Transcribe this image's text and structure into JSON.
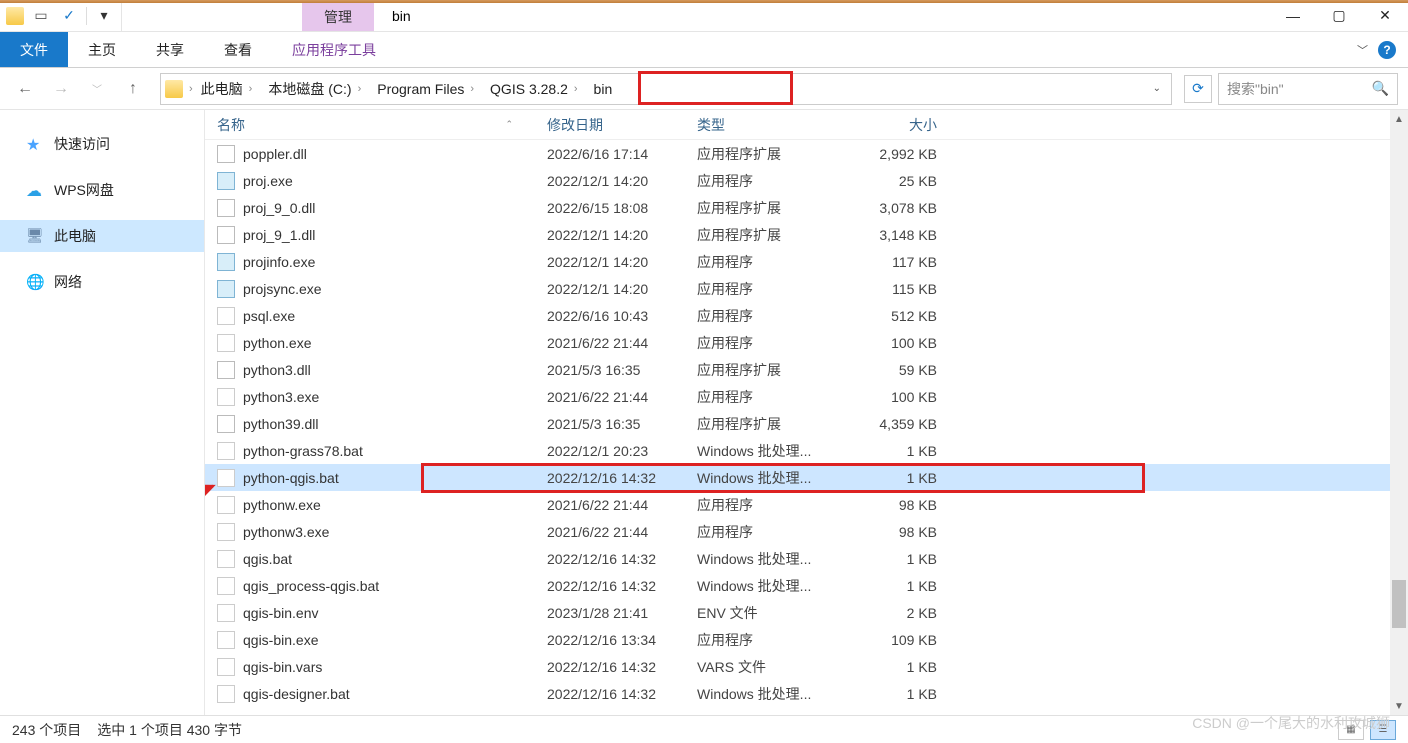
{
  "title": {
    "context_tab": "管理",
    "window": "bin"
  },
  "ribbon": {
    "file": "文件",
    "tabs": [
      "主页",
      "共享",
      "查看"
    ],
    "context": "应用程序工具"
  },
  "breadcrumb": {
    "items": [
      "此电脑",
      "本地磁盘 (C:)",
      "Program Files",
      "QGIS 3.28.2",
      "bin"
    ]
  },
  "search": {
    "placeholder": "搜索\"bin\""
  },
  "navpane": {
    "items": [
      {
        "label": "快速访问"
      },
      {
        "label": "WPS网盘"
      },
      {
        "label": "此电脑"
      },
      {
        "label": "网络"
      }
    ]
  },
  "columns": {
    "name": "名称",
    "date": "修改日期",
    "type": "类型",
    "size": "大小"
  },
  "files": [
    {
      "name": "poppler.dll",
      "date": "2022/6/16 17:14",
      "type": "应用程序扩展",
      "size": "2,992 KB",
      "ico": "ico-dll"
    },
    {
      "name": "proj.exe",
      "date": "2022/12/1 14:20",
      "type": "应用程序",
      "size": "25 KB",
      "ico": "ico-exe-proj"
    },
    {
      "name": "proj_9_0.dll",
      "date": "2022/6/15 18:08",
      "type": "应用程序扩展",
      "size": "3,078 KB",
      "ico": "ico-dll"
    },
    {
      "name": "proj_9_1.dll",
      "date": "2022/12/1 14:20",
      "type": "应用程序扩展",
      "size": "3,148 KB",
      "ico": "ico-dll"
    },
    {
      "name": "projinfo.exe",
      "date": "2022/12/1 14:20",
      "type": "应用程序",
      "size": "117 KB",
      "ico": "ico-exe-proj"
    },
    {
      "name": "projsync.exe",
      "date": "2022/12/1 14:20",
      "type": "应用程序",
      "size": "115 KB",
      "ico": "ico-exe-proj"
    },
    {
      "name": "psql.exe",
      "date": "2022/6/16 10:43",
      "type": "应用程序",
      "size": "512 KB",
      "ico": "ico-psql"
    },
    {
      "name": "python.exe",
      "date": "2021/6/22 21:44",
      "type": "应用程序",
      "size": "100 KB",
      "ico": "ico-exe-py"
    },
    {
      "name": "python3.dll",
      "date": "2021/5/3 16:35",
      "type": "应用程序扩展",
      "size": "59 KB",
      "ico": "ico-dll"
    },
    {
      "name": "python3.exe",
      "date": "2021/6/22 21:44",
      "type": "应用程序",
      "size": "100 KB",
      "ico": "ico-exe-py"
    },
    {
      "name": "python39.dll",
      "date": "2021/5/3 16:35",
      "type": "应用程序扩展",
      "size": "4,359 KB",
      "ico": "ico-dll"
    },
    {
      "name": "python-grass78.bat",
      "date": "2022/12/1 20:23",
      "type": "Windows 批处理...",
      "size": "1 KB",
      "ico": "ico-bat"
    },
    {
      "name": "python-qgis.bat",
      "date": "2022/12/16 14:32",
      "type": "Windows 批处理...",
      "size": "1 KB",
      "ico": "ico-bat",
      "selected": true
    },
    {
      "name": "pythonw.exe",
      "date": "2021/6/22 21:44",
      "type": "应用程序",
      "size": "98 KB",
      "ico": "ico-exe-py"
    },
    {
      "name": "pythonw3.exe",
      "date": "2021/6/22 21:44",
      "type": "应用程序",
      "size": "98 KB",
      "ico": "ico-exe-py"
    },
    {
      "name": "qgis.bat",
      "date": "2022/12/16 14:32",
      "type": "Windows 批处理...",
      "size": "1 KB",
      "ico": "ico-bat"
    },
    {
      "name": "qgis_process-qgis.bat",
      "date": "2022/12/16 14:32",
      "type": "Windows 批处理...",
      "size": "1 KB",
      "ico": "ico-bat"
    },
    {
      "name": "qgis-bin.env",
      "date": "2023/1/28 21:41",
      "type": "ENV 文件",
      "size": "2 KB",
      "ico": "ico-env"
    },
    {
      "name": "qgis-bin.exe",
      "date": "2022/12/16 13:34",
      "type": "应用程序",
      "size": "109 KB",
      "ico": "ico-q"
    },
    {
      "name": "qgis-bin.vars",
      "date": "2022/12/16 14:32",
      "type": "VARS 文件",
      "size": "1 KB",
      "ico": "ico-env"
    },
    {
      "name": "qgis-designer.bat",
      "date": "2022/12/16 14:32",
      "type": "Windows 批处理...",
      "size": "1 KB",
      "ico": "ico-bat"
    }
  ],
  "status": {
    "count": "243 个项目",
    "selection": "选中 1 个项目 430 字节"
  },
  "watermark": "CSDN @一个尾大的水利攻城狮"
}
